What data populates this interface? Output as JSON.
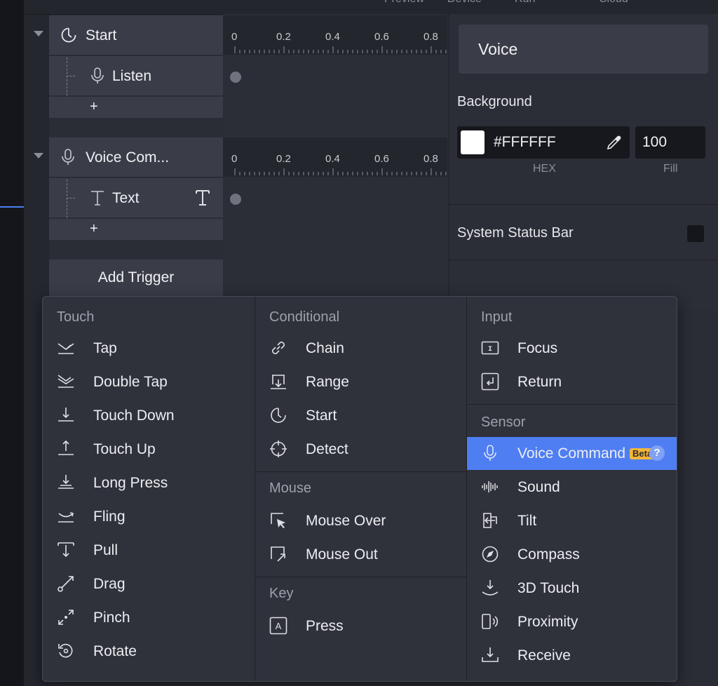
{
  "topbar": {
    "ghost_labels": [
      "Preview",
      "Device",
      "Run",
      "Cloud"
    ]
  },
  "triggers": [
    {
      "name": "Start",
      "icon": "clock-icon",
      "children": [
        {
          "name": "Listen",
          "icon": "microphone-icon"
        }
      ]
    },
    {
      "name": "Voice Com...",
      "icon": "microphone-icon",
      "children": [
        {
          "name": "Text",
          "icon": "text-icon"
        }
      ]
    }
  ],
  "timeline": {
    "ticks": [
      "0",
      "0.2",
      "0.4",
      "0.6",
      "0.8"
    ]
  },
  "add_trigger_label": "Add Trigger",
  "tree_add_symbol": "+",
  "inspector": {
    "title": "Voice",
    "background_label": "Background",
    "hex_value": "#FFFFFF",
    "hex_caption": "HEX",
    "fill_value": "100",
    "fill_caption": "Fill",
    "swatch_color": "#FFFFFF",
    "system_status_bar_label": "System Status Bar"
  },
  "menu": {
    "touch": {
      "title": "Touch",
      "items": [
        "Tap",
        "Double Tap",
        "Touch Down",
        "Touch Up",
        "Long Press",
        "Fling",
        "Pull",
        "Drag",
        "Pinch",
        "Rotate"
      ]
    },
    "conditional": {
      "title": "Conditional",
      "items": [
        "Chain",
        "Range",
        "Start",
        "Detect"
      ]
    },
    "mouse": {
      "title": "Mouse",
      "items": [
        "Mouse Over",
        "Mouse Out"
      ]
    },
    "key": {
      "title": "Key",
      "items": [
        "Press"
      ]
    },
    "input": {
      "title": "Input",
      "items": [
        "Focus",
        "Return"
      ]
    },
    "sensor": {
      "title": "Sensor",
      "items": [
        "Voice Command",
        "Sound",
        "Tilt",
        "Compass",
        "3D Touch",
        "Proximity",
        "Receive"
      ],
      "beta_label": "Beta",
      "help_symbol": "?"
    },
    "key_press_letter": "A",
    "focus_letter": "I"
  },
  "colors": {
    "accent": "#4F7EF2",
    "beta_badge": "#F2B63A"
  }
}
